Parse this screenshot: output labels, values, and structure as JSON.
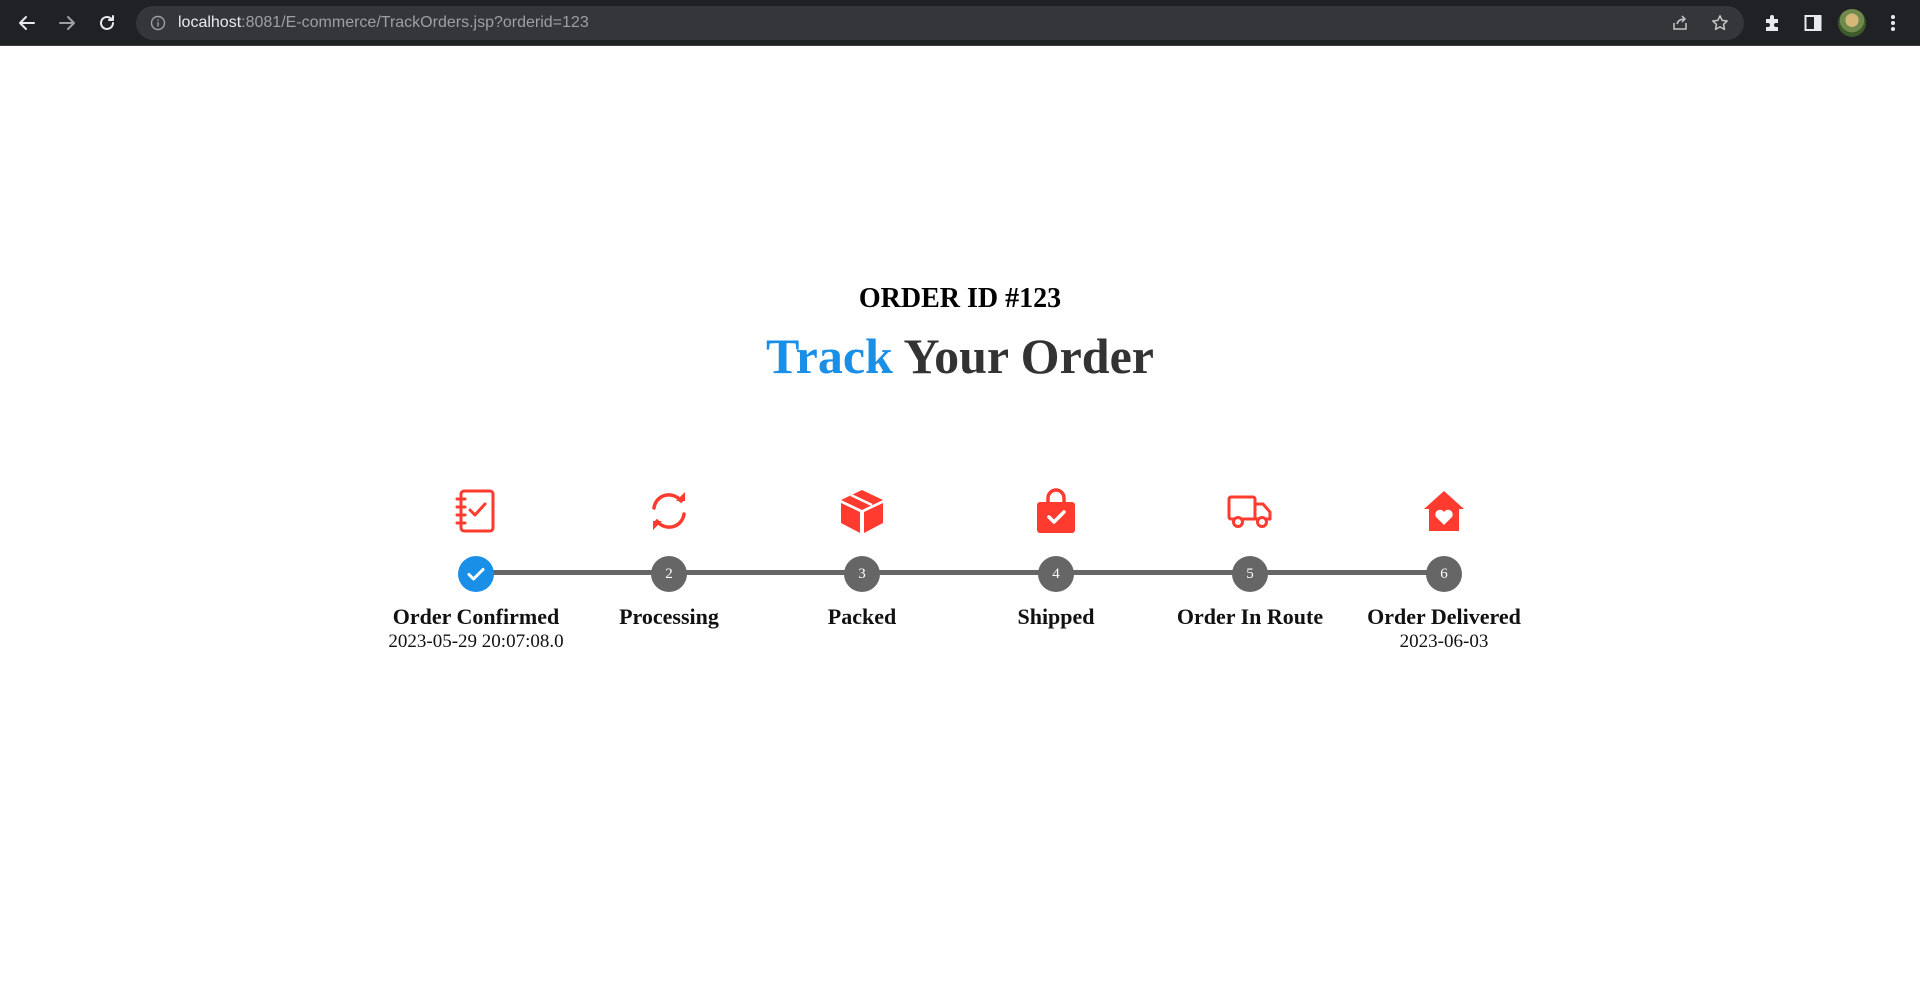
{
  "browser": {
    "url_host": "localhost",
    "url_rest": ":8081/E-commerce/TrackOrders.jsp?orderid=123",
    "icons": [
      "back-arrow-icon",
      "forward-arrow-icon",
      "reload-icon",
      "site-info-icon",
      "share-icon",
      "bookmark-star-icon",
      "extensions-puzzle-icon",
      "side-panel-icon",
      "profile-avatar",
      "menu-kebab-icon"
    ]
  },
  "page": {
    "order_id": "ORDER ID #123",
    "title_accent": "Track",
    "title_rest": " Your Order",
    "accent_color": "#1a8fe8",
    "icon_color": "#ff3b2f"
  },
  "tracker": {
    "completed_color": "#1a8fe8",
    "pending_color": "#666666",
    "steps": [
      {
        "number": "",
        "label": "Order Confirmed",
        "date": "2023-05-29 20:07:08.0",
        "status": "done",
        "icon": "clipboard-check-icon"
      },
      {
        "number": "2",
        "label": "Processing",
        "date": "",
        "status": "pending",
        "icon": "sync-arrows-icon"
      },
      {
        "number": "3",
        "label": "Packed",
        "date": "",
        "status": "pending",
        "icon": "box-icon"
      },
      {
        "number": "4",
        "label": "Shipped",
        "date": "",
        "status": "pending",
        "icon": "shopping-bag-check-icon"
      },
      {
        "number": "5",
        "label": "Order In Route",
        "date": "",
        "status": "pending",
        "icon": "delivery-truck-icon"
      },
      {
        "number": "6",
        "label": "Order Delivered",
        "date": "2023-06-03",
        "status": "pending",
        "icon": "home-heart-icon"
      }
    ]
  }
}
